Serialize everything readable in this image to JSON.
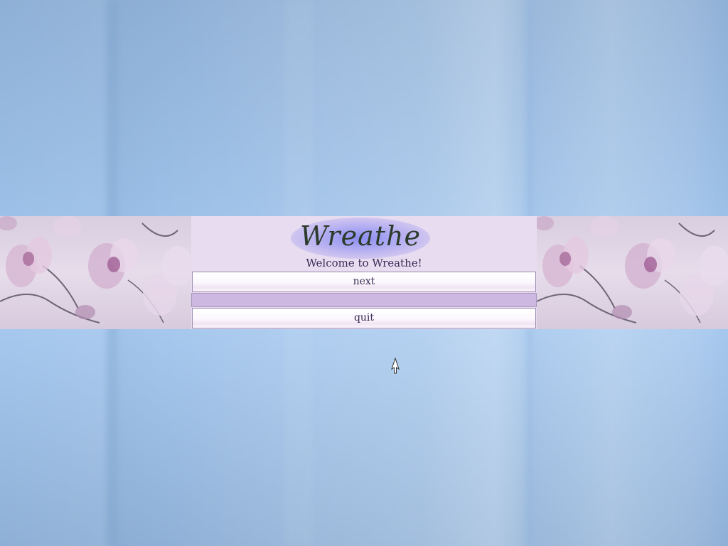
{
  "app": {
    "title": "Wreathe",
    "welcome_text": "Welcome to Wreathe!"
  },
  "menu": {
    "next_label": "next",
    "quit_label": "quit"
  },
  "colors": {
    "panel_bg": "#e8ddf0",
    "separator": "#cdb8e2",
    "text": "#3b2a55",
    "logo_glow": "#8c8cf0",
    "wallpaper": "#9cc0e8"
  },
  "icons": {
    "cursor": "mouse-pointer-icon",
    "decoration": "orchid-flowers"
  }
}
